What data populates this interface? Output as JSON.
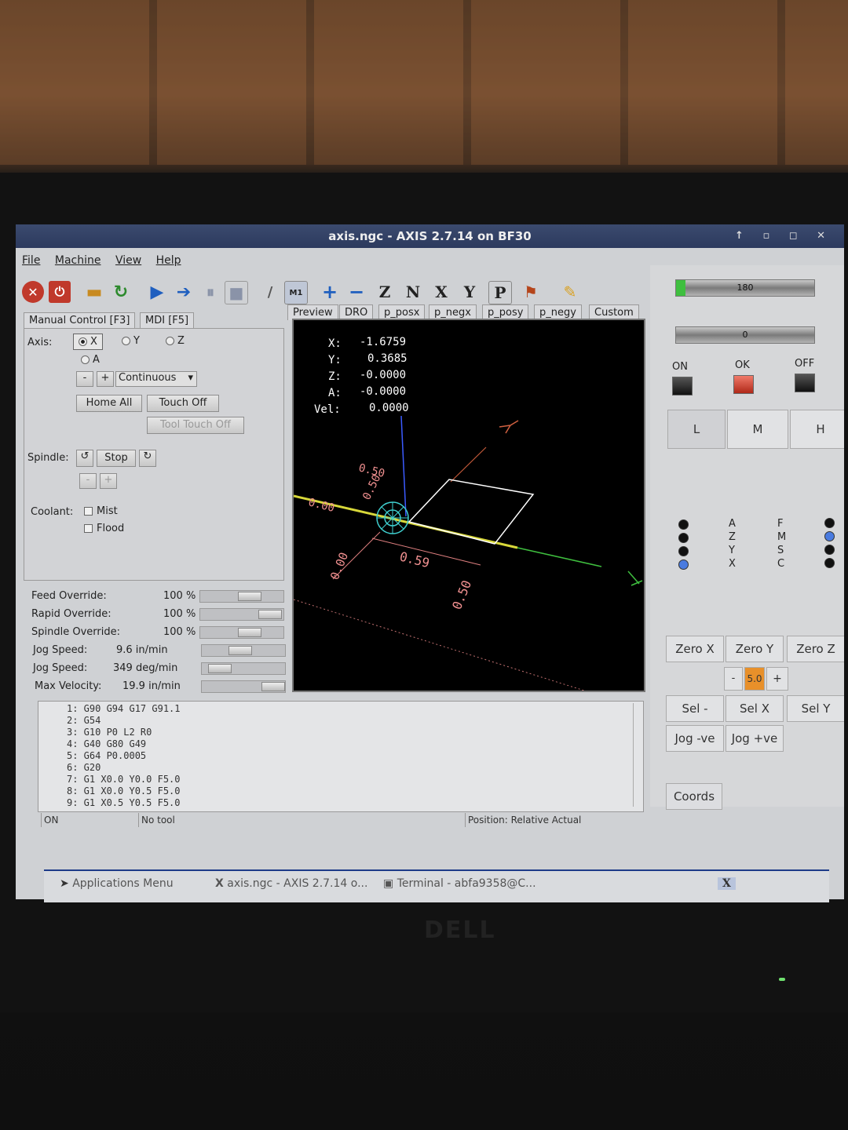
{
  "window": {
    "title": "axis.ngc - AXIS 2.7.14 on BF30",
    "controls": "↑ ▫ ◻ ✕"
  },
  "menu": [
    "File",
    "Machine",
    "View",
    "Help"
  ],
  "toolbar": {
    "letters": {
      "z": "Z",
      "n": "N",
      "x": "X",
      "y": "Y",
      "p": "P"
    },
    "m1": "M1"
  },
  "tabs": {
    "manual": "Manual Control [F3]",
    "mdi": "MDI [F5]"
  },
  "manual": {
    "axis_label": "Axis:",
    "axes": [
      "X",
      "Y",
      "Z",
      "A"
    ],
    "selected_axis": "X",
    "jog_minus": "-",
    "jog_plus": "+",
    "increment": "Continuous",
    "home_all": "Home All",
    "touch_off": "Touch Off",
    "tool_touch_off": "Tool Touch Off",
    "spindle_label": "Spindle:",
    "spindle_stop": "Stop",
    "spindle_minus": "-",
    "spindle_plus": "+",
    "coolant_label": "Coolant:",
    "mist": "Mist",
    "flood": "Flood"
  },
  "overrides": [
    {
      "label": "Feed Override:",
      "value": "100 %"
    },
    {
      "label": "Rapid Override:",
      "value": "100 %"
    },
    {
      "label": "Spindle Override:",
      "value": "100 %"
    },
    {
      "label": "Jog Speed:",
      "value": "9.6 in/min"
    },
    {
      "label": "Jog Speed:",
      "value": "349 deg/min"
    },
    {
      "label": "Max Velocity:",
      "value": "19.9 in/min"
    }
  ],
  "preview_tabs": [
    "Preview",
    "DRO",
    "p_posx",
    "p_negx",
    "p_posy",
    "p_negy",
    "Custom"
  ],
  "dro": {
    "x_label": "X:",
    "x": "-1.6759",
    "y_label": "Y:",
    "y": "0.3685",
    "z_label": "Z:",
    "z": "-0.0000",
    "a_label": "A:",
    "a": "-0.0000",
    "vel_label": "Vel:",
    "vel": "0.0000"
  },
  "preview_dims": {
    "d1": "0.50",
    "d2": "0.50",
    "d3": "0.00",
    "d4": "0.00",
    "d5": "0.59",
    "d6": "0.50"
  },
  "gcode": [
    "1: G90 G94 G17 G91.1",
    "2: G54",
    "3: G10 P0 L2 R0",
    "4: G40 G80 G49",
    "5: G64 P0.0005",
    "6: G20",
    "7: G1 X0.0 Y0.0 F5.0",
    "8: G1 X0.0 Y0.5 F5.0",
    "9: G1 X0.5 Y0.5 F5.0"
  ],
  "status": {
    "state": "ON",
    "tool": "No tool",
    "position": "Position: Relative Actual"
  },
  "right": {
    "bar1": "180",
    "bar2": "0",
    "on": "ON",
    "ok": "OK",
    "off": "OFF",
    "lmh": [
      "L",
      "M",
      "H"
    ],
    "axis_col": [
      "A",
      "Z",
      "Y",
      "X"
    ],
    "func_col": [
      "F",
      "M",
      "S",
      "C"
    ],
    "zero": [
      "Zero X",
      "Zero Y",
      "Zero Z"
    ],
    "step_minus": "-",
    "step_value": "5.0",
    "step_plus": "+",
    "sel_minus": "Sel -",
    "sel_x": "Sel X",
    "sel_y": "Sel Y",
    "jog_ve_minus": "Jog -ve",
    "jog_ve_plus": "Jog +ve",
    "coords": "Coords",
    "colors": {
      "ok_led": "#d94030",
      "on_led": "#222222",
      "blue_dot": "#4a7be0"
    }
  },
  "taskbar": {
    "apps": "Applications Menu",
    "task1": "axis.ngc - AXIS 2.7.14 o...",
    "task2": "Terminal - abfa9358@C...",
    "tray": "X"
  },
  "monitor": {
    "brand": "DELL"
  }
}
